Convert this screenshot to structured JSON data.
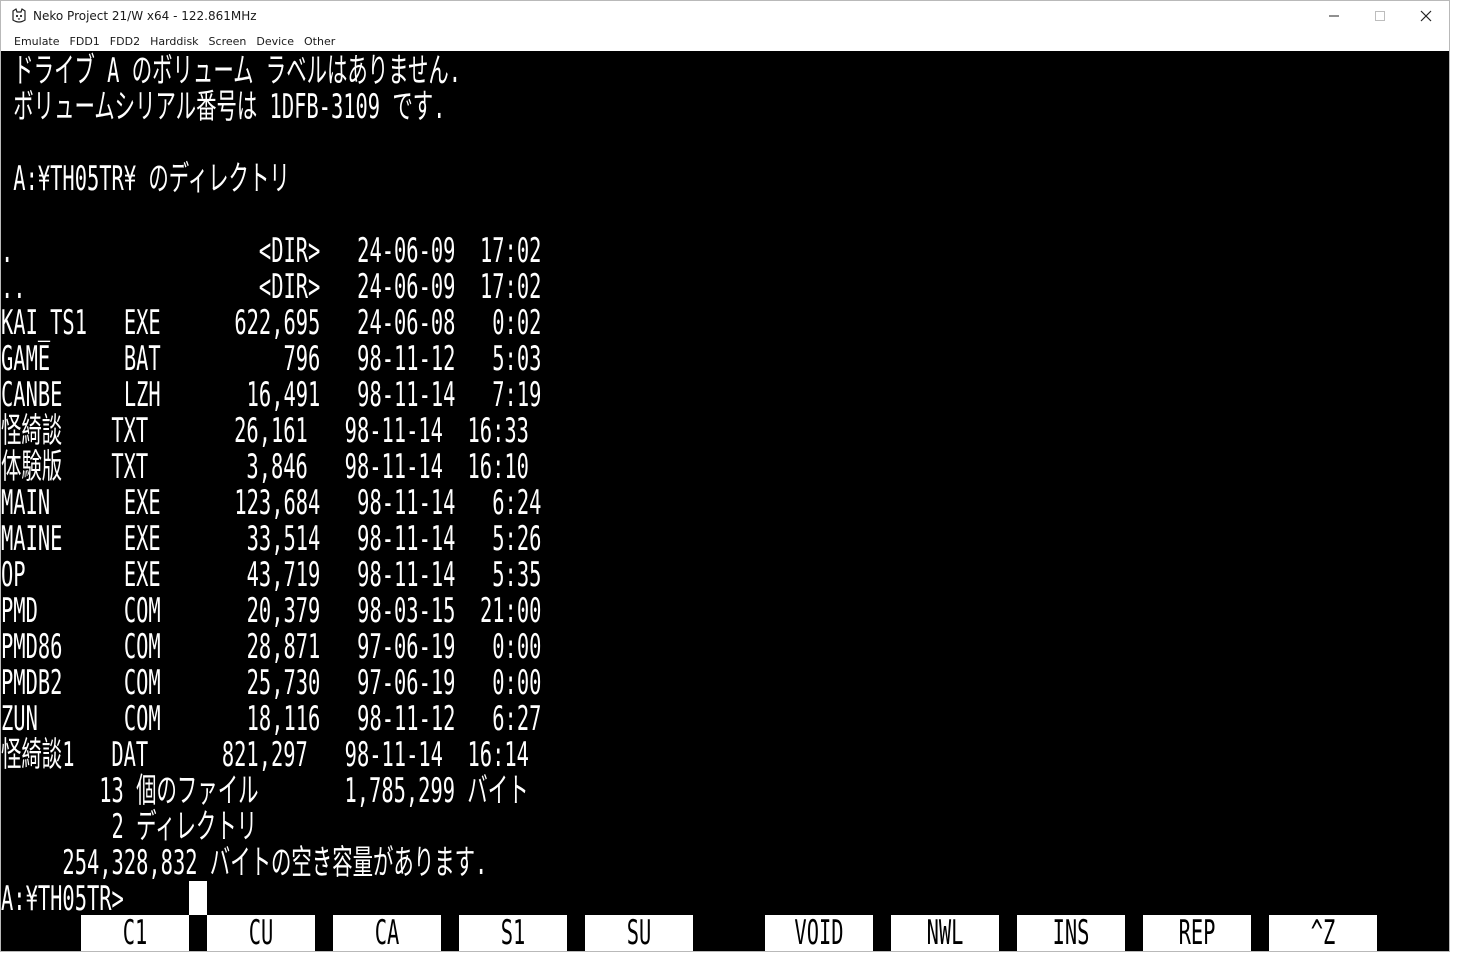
{
  "window": {
    "title": "Neko Project 21/W x64 - 122.861MHz",
    "icon": "cat-icon"
  },
  "menu": [
    "Emulate",
    "FDD1",
    "FDD2",
    "Harddisk",
    "Screen",
    "Device",
    "Other"
  ],
  "terminal": {
    "lines": [
      " ドライブ A のボリューム ラベルはありません.",
      " ボリュームシリアル番号は 1DFB-3109 です.",
      "",
      " A:¥TH05TR¥ のディレクトリ",
      "",
      ".                    <DIR>   24-06-09  17:02",
      "..                   <DIR>   24-06-09  17:02",
      "KAI_TS1   EXE      622,695   24-06-08   0:02",
      "GAME      BAT          796   98-11-12   5:03",
      "CANBE     LZH       16,491   98-11-14   7:19",
      "怪綺談    TXT       26,161   98-11-14  16:33",
      "体験版    TXT        3,846   98-11-14  16:10",
      "MAIN      EXE      123,684   98-11-14   6:24",
      "MAINE     EXE       33,514   98-11-14   5:26",
      "OP        EXE       43,719   98-11-14   5:35",
      "PMD       COM       20,379   98-03-15  21:00",
      "PMD86     COM       28,871   97-06-19   0:00",
      "PMDB2     COM       25,730   97-06-19   0:00",
      "ZUN       COM       18,116   98-11-12   6:27",
      "怪綺談1   DAT      821,297   98-11-14  16:14",
      "        13 個のファイル       1,785,299 バイト",
      "         2 ディレクトリ",
      "     254,328,832 バイトの空き容量があります.",
      "A:¥TH05TR>"
    ]
  },
  "function_keys": [
    {
      "label": "C1",
      "name": "fkey-f1"
    },
    {
      "label": "CU",
      "name": "fkey-f2"
    },
    {
      "label": "CA",
      "name": "fkey-f3"
    },
    {
      "label": "S1",
      "name": "fkey-f4"
    },
    {
      "label": "SU",
      "name": "fkey-f5"
    },
    {
      "label": "VOID",
      "name": "fkey-f6"
    },
    {
      "label": "NWL",
      "name": "fkey-f7"
    },
    {
      "label": "INS",
      "name": "fkey-f8"
    },
    {
      "label": "REP",
      "name": "fkey-f9"
    },
    {
      "label": "^Z",
      "name": "fkey-f10"
    }
  ]
}
